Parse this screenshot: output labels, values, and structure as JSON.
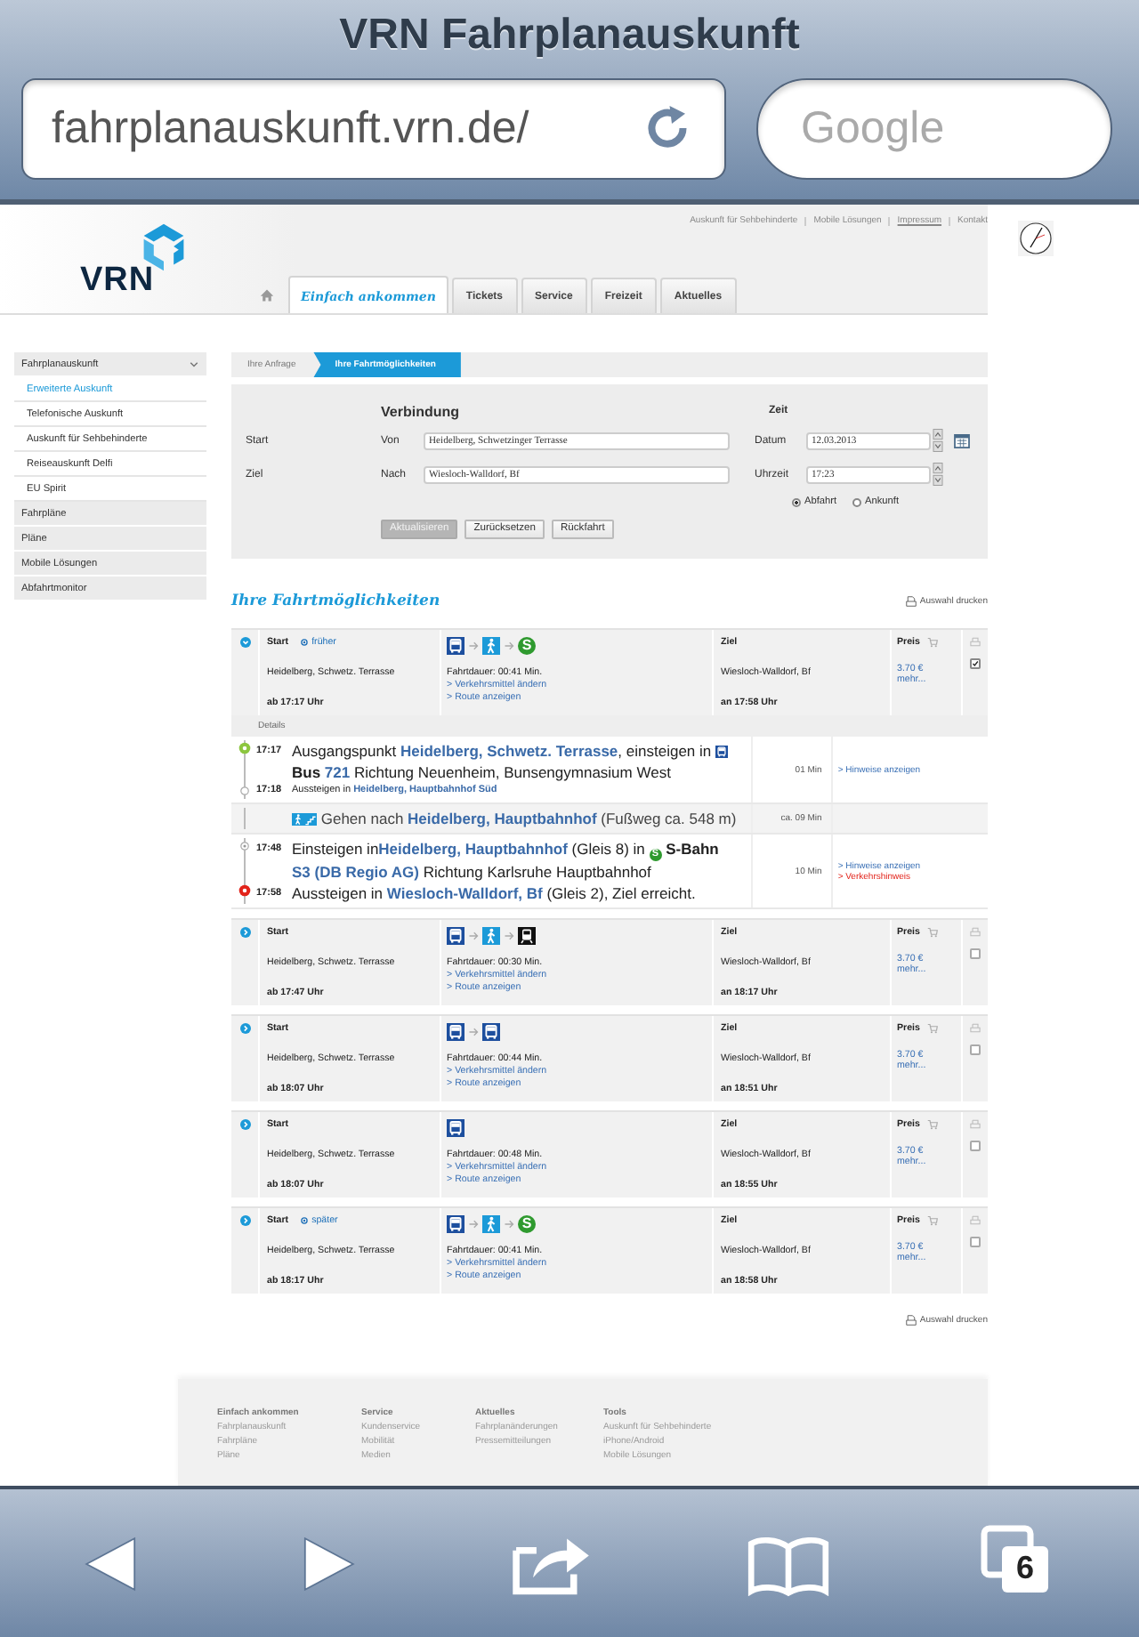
{
  "browser": {
    "title": "VRN Fahrplanauskunft",
    "url": "fahrplanauskunft.vrn.de/",
    "search_placeholder": "Google",
    "tab_count": "6"
  },
  "top_links": [
    {
      "label": "Auskunft für Sehbehinderte",
      "underlined": false
    },
    {
      "label": "Mobile Lösungen",
      "underlined": false
    },
    {
      "label": "Impressum",
      "underlined": true
    },
    {
      "label": "Kontakt",
      "underlined": false
    }
  ],
  "logo": "VRN",
  "nav_tabs": [
    {
      "label": "Einfach ankommen",
      "selected": true
    },
    {
      "label": "Tickets",
      "selected": false
    },
    {
      "label": "Service",
      "selected": false
    },
    {
      "label": "Freizeit",
      "selected": false
    },
    {
      "label": "Aktuelles",
      "selected": false
    }
  ],
  "sidebar": [
    {
      "label": "Fahrplanauskunft",
      "children": [
        {
          "label": "Erweiterte Auskunft",
          "selected": true
        },
        {
          "label": "Telefonische Auskunft",
          "selected": false
        },
        {
          "label": "Auskunft für Sehbehinderte",
          "selected": false
        },
        {
          "label": "Reiseauskunft Delfi",
          "selected": false
        },
        {
          "label": "EU Spirit",
          "selected": false
        }
      ]
    },
    {
      "label": "Fahrpläne"
    },
    {
      "label": "Pläne"
    },
    {
      "label": "Mobile Lösungen"
    },
    {
      "label": "Abfahrtmonitor"
    }
  ],
  "breadcrumb": [
    {
      "label": "Ihre Anfrage",
      "selected": false
    },
    {
      "label": "Ihre Fahrtmöglichkeiten",
      "selected": true
    }
  ],
  "form": {
    "heading_connection": "Verbindung",
    "heading_time": "Zeit",
    "rows": [
      {
        "label": "Start",
        "field_label": "Von",
        "value": "Heidelberg, Schwetzinger Terrasse",
        "time_label": "Datum",
        "time_value": "12.03.2013",
        "calendar": true
      },
      {
        "label": "Ziel",
        "field_label": "Nach",
        "value": "Wiesloch-Walldorf, Bf",
        "time_label": "Uhrzeit",
        "time_value": "17:23"
      }
    ],
    "radios": [
      {
        "label": "Abfahrt",
        "selected": true
      },
      {
        "label": "Ankunft",
        "selected": false
      }
    ],
    "buttons": [
      {
        "label": "Aktualisieren",
        "disabled": true
      },
      {
        "label": "Zurücksetzen",
        "disabled": false
      },
      {
        "label": "Rückfahrt",
        "disabled": false
      }
    ]
  },
  "results": {
    "title": "Ihre Fahrtmöglichkeiten",
    "print_top": "Auswahl drucken",
    "print_bottom": "Auswahl drucken",
    "trips": [
      {
        "expanded": true,
        "start_label": "Start",
        "shift": "früher",
        "from": "Heidelberg, Schwetz. Terrasse",
        "dep": "ab 17:17 Uhr",
        "modes": [
          {
            "kind": "bus"
          },
          {
            "kind": "walk"
          },
          {
            "kind": "sbahn",
            "label": "S"
          }
        ],
        "duration": "Fahrtdauer: 00:41 Min.",
        "link_change": "> Verkehrsmittel ändern",
        "link_route": "> Route anzeigen",
        "ziel_label": "Ziel",
        "to": "Wiesloch-Walldorf, Bf",
        "arr": "an 17:58 Uhr",
        "price_label": "Preis",
        "price": "3.70 €",
        "more": "mehr...",
        "checked": true,
        "details": {
          "heading": "Details",
          "legs": [
            {
              "kind": "ride",
              "duration": "01 Min",
              "notes": [
                {
                  "text": "> Hinweise anzeigen",
                  "kind": "info"
                }
              ],
              "lines": [
                {
                  "kind": "start",
                  "time": "17:17",
                  "small": false,
                  "parts": [
                    {
                      "kind": "text",
                      "text": "Ausgangspunkt "
                    },
                    {
                      "kind": "link",
                      "text": "Heidelberg, Schwetz. Terrasse"
                    },
                    {
                      "kind": "text",
                      "text": ", einsteigen in "
                    },
                    {
                      "kind": "bus"
                    },
                    {
                      "kind": "bold",
                      "text": " Bus"
                    },
                    {
                      "kind": "link",
                      "text": " 721"
                    },
                    {
                      "kind": "text",
                      "text": " Richtung Neuenheim, Bunsengymnasium West"
                    }
                  ]
                },
                {
                  "kind": "via",
                  "time": "17:18",
                  "small": true,
                  "parts": [
                    {
                      "kind": "text",
                      "text": "Aussteigen in "
                    },
                    {
                      "kind": "link",
                      "text": "Heidelberg, Hauptbahnhof Süd"
                    }
                  ]
                }
              ]
            },
            {
              "kind": "walk",
              "duration": "ca. 09 Min",
              "lines": [
                {
                  "kind": "plain",
                  "small": false,
                  "parts": [
                    {
                      "kind": "walk"
                    },
                    {
                      "kind": "stairs"
                    },
                    {
                      "kind": "text",
                      "text": " Gehen nach "
                    },
                    {
                      "kind": "link",
                      "text": "Heidelberg, Hauptbahnhof"
                    },
                    {
                      "kind": "text",
                      "text": " (Fußweg ca. 548 m)"
                    }
                  ]
                }
              ]
            },
            {
              "kind": "ride",
              "duration": "10 Min",
              "notes": [
                {
                  "text": "> Hinweise anzeigen",
                  "kind": "info"
                },
                {
                  "text": "> Verkehrshinweis",
                  "kind": "warning"
                }
              ],
              "lines": [
                {
                  "kind": "stop",
                  "time": "17:48",
                  "small": false,
                  "parts": [
                    {
                      "kind": "text",
                      "text": "Einsteigen in"
                    },
                    {
                      "kind": "link",
                      "text": "Heidelberg, Hauptbahnhof"
                    },
                    {
                      "kind": "text",
                      "text": " (Gleis 8) in "
                    },
                    {
                      "kind": "sbahn",
                      "label": "S"
                    },
                    {
                      "kind": "bold",
                      "text": " S-Bahn"
                    },
                    {
                      "kind": "link",
                      "text": " S3 (DB Regio AG)"
                    },
                    {
                      "kind": "text",
                      "text": " Richtung Karlsruhe Hauptbahnhof"
                    }
                  ]
                },
                {
                  "kind": "end",
                  "time": "17:58",
                  "small": false,
                  "parts": [
                    {
                      "kind": "text",
                      "text": "Aussteigen in "
                    },
                    {
                      "kind": "link",
                      "text": "Wiesloch-Walldorf, Bf"
                    },
                    {
                      "kind": "text",
                      "text": " (Gleis 2), Ziel erreicht."
                    }
                  ]
                }
              ]
            }
          ]
        }
      },
      {
        "expanded": false,
        "start_label": "Start",
        "from": "Heidelberg, Schwetz. Terrasse",
        "dep": "ab 17:47 Uhr",
        "modes": [
          {
            "kind": "bus"
          },
          {
            "kind": "walk"
          },
          {
            "kind": "train"
          }
        ],
        "duration": "Fahrtdauer: 00:30 Min.",
        "link_change": "> Verkehrsmittel ändern",
        "link_route": "> Route anzeigen",
        "ziel_label": "Ziel",
        "to": "Wiesloch-Walldorf, Bf",
        "arr": "an 18:17 Uhr",
        "price_label": "Preis",
        "price": "3.70 €",
        "more": "mehr...",
        "checked": false
      },
      {
        "expanded": false,
        "start_label": "Start",
        "from": "Heidelberg, Schwetz. Terrasse",
        "dep": "ab 18:07 Uhr",
        "modes": [
          {
            "kind": "bus"
          },
          {
            "kind": "bus"
          }
        ],
        "duration": "Fahrtdauer: 00:44 Min.",
        "link_change": "> Verkehrsmittel ändern",
        "link_route": "> Route anzeigen",
        "ziel_label": "Ziel",
        "to": "Wiesloch-Walldorf, Bf",
        "arr": "an 18:51 Uhr",
        "price_label": "Preis",
        "price": "3.70 €",
        "more": "mehr...",
        "checked": false
      },
      {
        "expanded": false,
        "start_label": "Start",
        "from": "Heidelberg, Schwetz. Terrasse",
        "dep": "ab 18:07 Uhr",
        "modes": [
          {
            "kind": "bus"
          }
        ],
        "duration": "Fahrtdauer: 00:48 Min.",
        "link_change": "> Verkehrsmittel ändern",
        "link_route": "> Route anzeigen",
        "ziel_label": "Ziel",
        "to": "Wiesloch-Walldorf, Bf",
        "arr": "an 18:55 Uhr",
        "price_label": "Preis",
        "price": "3.70 €",
        "more": "mehr...",
        "checked": false
      },
      {
        "expanded": false,
        "start_label": "Start",
        "shift": "später",
        "from": "Heidelberg, Schwetz. Terrasse",
        "dep": "ab 18:17 Uhr",
        "modes": [
          {
            "kind": "bus"
          },
          {
            "kind": "walk"
          },
          {
            "kind": "sbahn",
            "label": "S"
          }
        ],
        "duration": "Fahrtdauer: 00:41 Min.",
        "link_change": "> Verkehrsmittel ändern",
        "link_route": "> Route anzeigen",
        "ziel_label": "Ziel",
        "to": "Wiesloch-Walldorf, Bf",
        "arr": "an 18:58 Uhr",
        "price_label": "Preis",
        "price": "3.70 €",
        "more": "mehr...",
        "checked": false
      }
    ]
  },
  "footer": [
    {
      "heading": "Einfach ankommen",
      "links": [
        "Fahrplanauskunft",
        "Fahrpläne",
        "Pläne"
      ]
    },
    {
      "heading": "Service",
      "links": [
        "Kundenservice",
        "Mobilität",
        "Medien"
      ]
    },
    {
      "heading": "Aktuelles",
      "links": [
        "Fahrplanänderungen",
        "Pressemitteilungen"
      ]
    },
    {
      "heading": "Tools",
      "links": [
        "Auskunft für Sehbehinderte",
        "iPhone/Android",
        "Mobile Lösungen"
      ]
    }
  ]
}
